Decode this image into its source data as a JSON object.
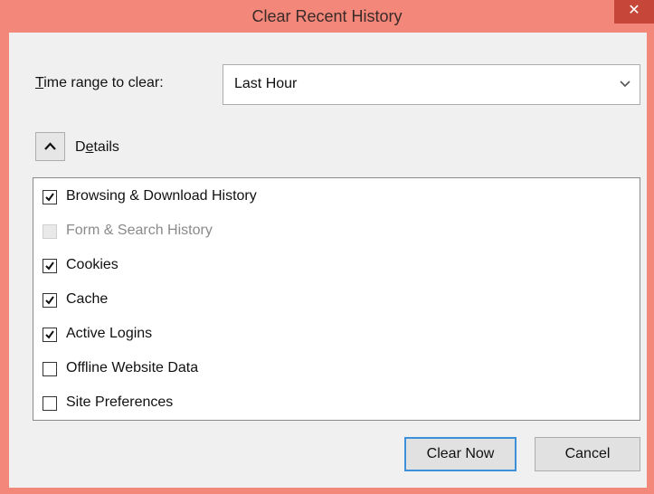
{
  "window": {
    "title": "Clear Recent History",
    "close_glyph": "✕"
  },
  "time_range": {
    "label_prefix_ul": "T",
    "label_rest": "ime range to clear:",
    "selected": "Last Hour",
    "arrow_glyph": "⌄"
  },
  "details": {
    "label_before": "D",
    "label_ul": "e",
    "label_after": "tails"
  },
  "items": [
    {
      "label": "Browsing & Download History",
      "checked": true,
      "disabled": false
    },
    {
      "label": "Form & Search History",
      "checked": false,
      "disabled": true
    },
    {
      "label": "Cookies",
      "checked": true,
      "disabled": false
    },
    {
      "label": "Cache",
      "checked": true,
      "disabled": false
    },
    {
      "label": "Active Logins",
      "checked": true,
      "disabled": false
    },
    {
      "label": "Offline Website Data",
      "checked": false,
      "disabled": false
    },
    {
      "label": "Site Preferences",
      "checked": false,
      "disabled": false
    }
  ],
  "buttons": {
    "clear_now": "Clear Now",
    "cancel": "Cancel"
  },
  "colors": {
    "titlebar": "#f3877a",
    "close": "#c7463a",
    "focus_border": "#3c8fd9"
  }
}
